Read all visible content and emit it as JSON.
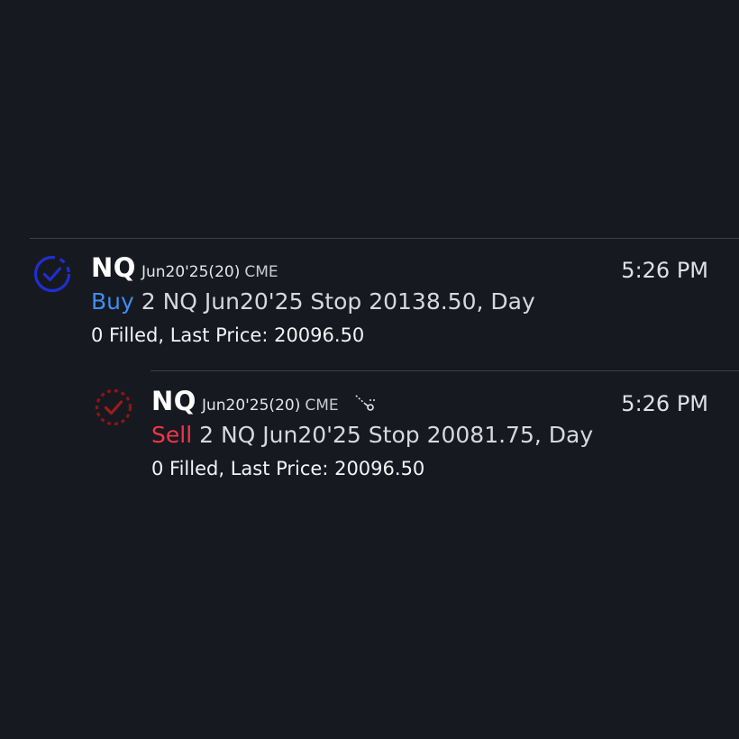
{
  "orders": [
    {
      "symbol": "NQ",
      "contract": "Jun20'25(20)",
      "exchange": "CME",
      "time": "5:26 PM",
      "side": "Buy",
      "description": " 2 NQ Jun20'25 Stop 20138.50, Day",
      "fill_status": "0 Filled, Last Price: 20096.50",
      "status_icon": "check-circle-icon",
      "status_color": "#1f2fd0"
    },
    {
      "symbol": "NQ",
      "contract": "Jun20'25(20)",
      "exchange": "CME",
      "time": "5:26 PM",
      "side": "Sell",
      "description": " 2 NQ Jun20'25 Stop 20081.75, Day",
      "fill_status": "0 Filled, Last Price: 20096.50",
      "status_icon": "check-circle-icon",
      "status_color": "#8a1616",
      "extra_icon": "bracket-link-icon"
    }
  ],
  "colors": {
    "background": "#171920",
    "buy": "#3f8ef0",
    "sell": "#f0364a",
    "divider": "#3d4049"
  }
}
